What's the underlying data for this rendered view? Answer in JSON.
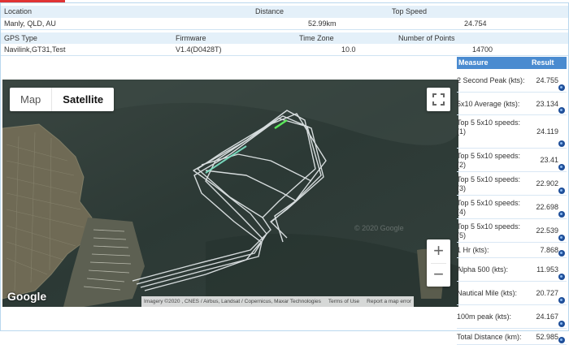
{
  "summary": {
    "location_label": "Location",
    "location_value": "Manly, QLD, AU",
    "distance_label": "Distance",
    "distance_value": "52.99km",
    "top_speed_label": "Top Speed",
    "top_speed_value": "24.754"
  },
  "device": {
    "gps_type_label": "GPS Type",
    "gps_type_value": "Navilink,GT31,Test",
    "firmware_label": "Firmware",
    "firmware_value": "V1.4(D0428T)",
    "time_zone_label": "Time Zone",
    "time_zone_value": "10.0",
    "points_label": "Number of Points",
    "points_value": "14700"
  },
  "map": {
    "map_type_options": [
      "Map",
      "Satellite"
    ],
    "selected_map_type": "Satellite",
    "zoom_in_label": "+",
    "zoom_out_label": "−",
    "logo_text": "Google",
    "watermark": "© 2020 Google",
    "attribution": "Imagery ©2020 , CNES / Airbus, Landsat / Copernicus, Maxar Technologies",
    "terms_link": "Terms of Use",
    "report_link": "Report a map error",
    "icons": [
      "fullscreen-icon",
      "zoom-in-icon",
      "zoom-out-icon"
    ]
  },
  "stats": {
    "header_measure": "Measure",
    "header_result": "Result",
    "rows": [
      {
        "label": "2 Second Peak (kts):",
        "value": "24.755"
      },
      {
        "label": "5x10 Average (kts):",
        "value": "23.134"
      },
      {
        "label": "Top 5 5x10 speeds: (1)",
        "value": "24.119"
      },
      {
        "label": "Top 5 5x10 speeds: (2)",
        "value": "23.41"
      },
      {
        "label": "Top 5 5x10 speeds: (3)",
        "value": "22.902"
      },
      {
        "label": "Top 5 5x10 speeds: (4)",
        "value": "22.698"
      },
      {
        "label": "Top 5 5x10 speeds: (5)",
        "value": "22.539"
      },
      {
        "label": "1 Hr (kts):",
        "value": "7.868"
      },
      {
        "label": "Alpha 500 (kts):",
        "value": "11.953"
      },
      {
        "label": "Nautical Mile (kts):",
        "value": "20.727"
      },
      {
        "label": "100m peak (kts):",
        "value": "24.167"
      },
      {
        "label": "Total Distance (km):",
        "value": "52.985"
      }
    ],
    "row_icon": "globe-icon"
  },
  "colors": {
    "header_bg": "#e4f0f9",
    "side_header_bg": "#4a8bd0",
    "accent": "#e03434",
    "globe": "#1f4f9a"
  }
}
